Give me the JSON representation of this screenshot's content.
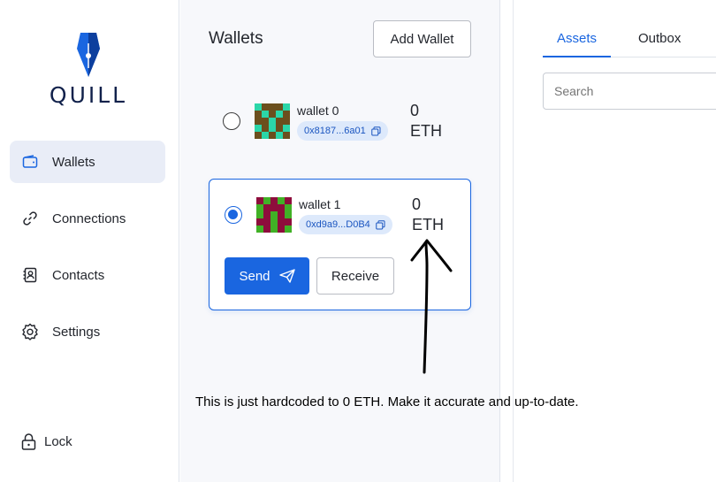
{
  "brand": {
    "name": "QUILL",
    "primary_color": "#1a66e0",
    "logo_icon": "pen-nib-icon"
  },
  "sidebar": {
    "items": [
      {
        "label": "Wallets",
        "icon": "wallet-icon",
        "active": true
      },
      {
        "label": "Connections",
        "icon": "link-icon",
        "active": false
      },
      {
        "label": "Contacts",
        "icon": "contacts-book-icon",
        "active": false
      },
      {
        "label": "Settings",
        "icon": "gear-icon",
        "active": false
      }
    ],
    "lock_label": "Lock"
  },
  "wallets": {
    "title": "Wallets",
    "add_label": "Add Wallet",
    "list": [
      {
        "name": "wallet 0",
        "address": "0x8187...6a01",
        "balance_amount": "0",
        "balance_unit": "ETH",
        "selected": false
      },
      {
        "name": "wallet 1",
        "address": "0xd9a9...D0B4",
        "balance_amount": "0",
        "balance_unit": "ETH",
        "selected": true
      }
    ],
    "send_label": "Send",
    "receive_label": "Receive"
  },
  "right_panel": {
    "tabs": [
      {
        "label": "Assets",
        "active": true
      },
      {
        "label": "Outbox",
        "active": false
      }
    ],
    "search_placeholder": "Search"
  },
  "annotation": {
    "text": "This is just hardcoded to 0 ETH. Make it accurate and up-to-date."
  }
}
